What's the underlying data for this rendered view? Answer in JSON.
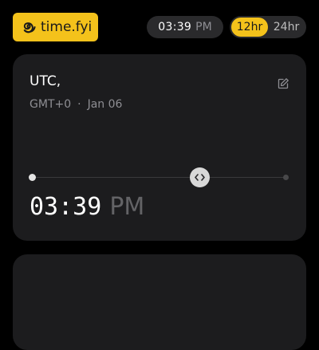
{
  "header": {
    "logo_text": "time.fyi",
    "logo_icon": "spiral-icon",
    "current_time": "03:39",
    "current_meridiem": "PM",
    "format_toggle": {
      "option_12": "12hr",
      "option_24": "24hr",
      "selected": "12hr"
    }
  },
  "card": {
    "title": "UTC,",
    "offset": "GMT+0",
    "separator": "·",
    "date": "Jan 06",
    "edit_icon": "pencil-icon",
    "slider_knob_icon": "chevron-left-right-icon",
    "slider_value_fraction": 0.66,
    "time": "03:39",
    "meridiem": "PM"
  },
  "colors": {
    "accent": "#f4c21b",
    "background": "#000000",
    "card": "#1c1c1e",
    "muted_text": "#8e8e93"
  }
}
